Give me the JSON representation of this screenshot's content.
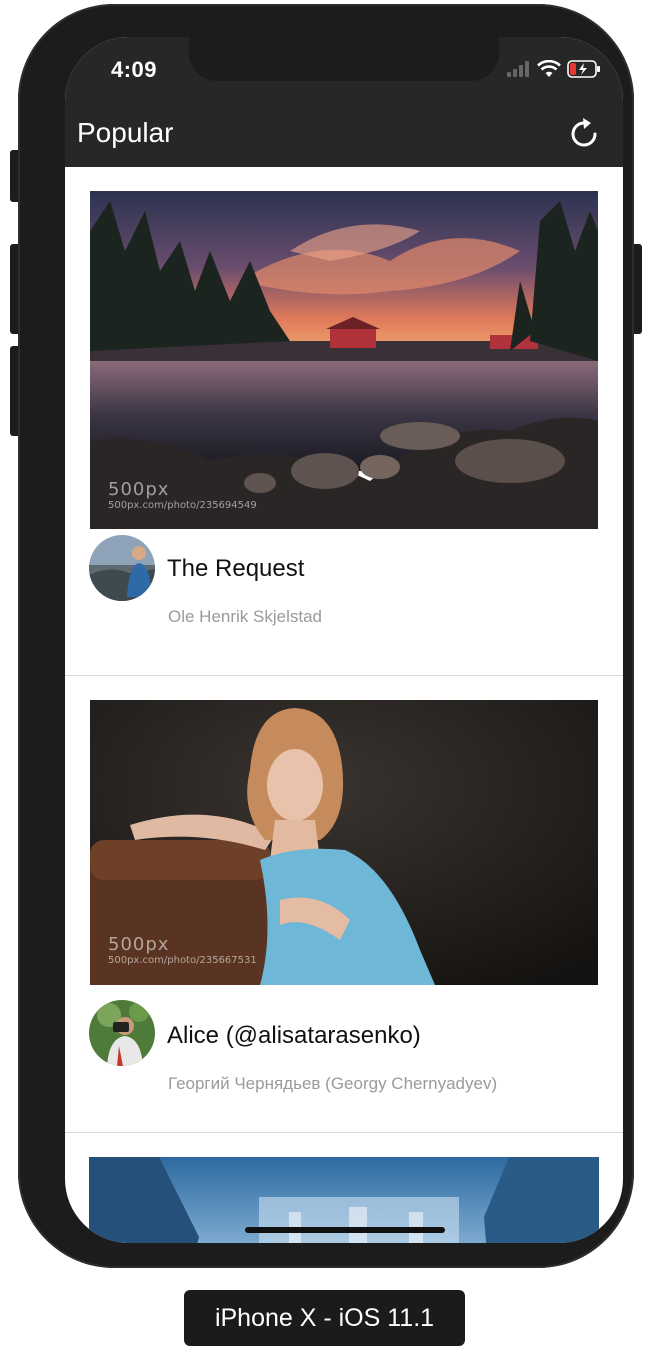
{
  "status_bar": {
    "time": "4:09"
  },
  "nav": {
    "title": "Popular",
    "refresh_icon": "refresh-icon"
  },
  "feed": [
    {
      "title": "The Request",
      "author": "Ole Henrik Skjelstad",
      "watermark_logo": "500px",
      "watermark_url": "500px.com/photo/235694549"
    },
    {
      "title": "Alice (@alisatarasenko)",
      "author": "Георгий  Чернядьев (Georgy Chernyadyev)",
      "watermark_logo": "500px",
      "watermark_url": "500px.com/photo/235667531"
    }
  ],
  "device_label": "iPhone X - iOS 11.1",
  "colors": {
    "nav_background": "#272727",
    "author_text": "#9a9a9a",
    "battery_low": "#e53935"
  }
}
